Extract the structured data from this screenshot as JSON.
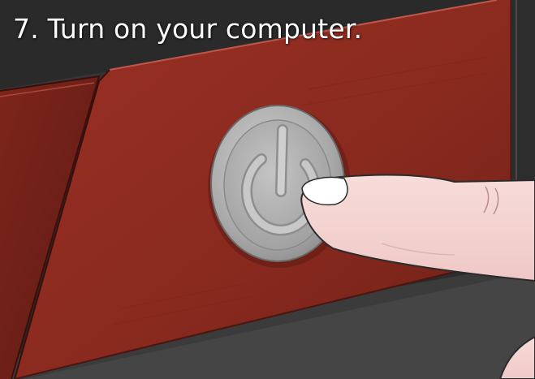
{
  "step": {
    "caption": "7. Turn on your computer."
  },
  "illustration": {
    "subject": "power-button-pressed-by-finger",
    "colors": {
      "panel": "#8e2c20",
      "panel_dark": "#5a1a14",
      "case": "#3a3a3a",
      "button": "#a9a9a9",
      "skin": "#f6d8d6"
    },
    "icons": [
      "power-icon"
    ]
  }
}
